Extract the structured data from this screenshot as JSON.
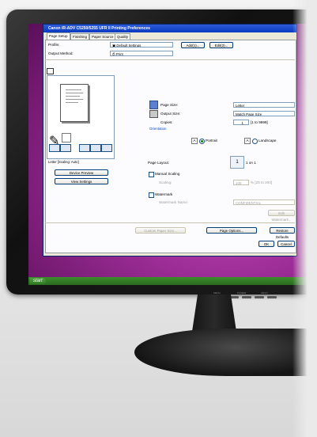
{
  "window": {
    "title": "Canon iR-ADV C5250/5255 UFR II Printing Preferences"
  },
  "tabs": [
    "Page Setup",
    "Finishing",
    "Paper Source",
    "Quality"
  ],
  "profile": {
    "label": "Profile:",
    "value": "Default Settings",
    "add_label": "Add(1)...",
    "edit_label": "Edit(2)..."
  },
  "output_method": {
    "label": "Output Method:",
    "value": "Print"
  },
  "page_size": {
    "label": "Page Size:",
    "value": "Letter"
  },
  "output_size": {
    "label": "Output Size:",
    "value": "Match Page Size"
  },
  "copies": {
    "label": "Copies:",
    "value": "1",
    "range": "[1 to 9999]"
  },
  "orientation": {
    "group_label": "Orientation",
    "portrait": "Portrait",
    "landscape": "Landscape",
    "letter": "A"
  },
  "page_layout": {
    "label": "Page Layout:",
    "value": "1 on 1",
    "num": "1"
  },
  "manual_scaling": {
    "label": "Manual Scaling",
    "scaling_label": "Scaling:",
    "value": "100",
    "range": "% [25 to 200]"
  },
  "watermark": {
    "label": "Watermark",
    "name_label": "Watermark Name:",
    "value": "CONFIDENTIAL",
    "edit_label": "Edit Watermark..."
  },
  "preview": {
    "caption": "Letter [Scaling: Auto]",
    "device_preview": "Device Preview",
    "view_settings": "View Settings"
  },
  "buttons": {
    "custom_paper": "Custom Paper Size...",
    "page_options": "Page Options...",
    "restore": "Restore Defaults",
    "ok": "OK",
    "cancel": "Cancel"
  },
  "taskbar": {
    "start": "start"
  },
  "monitor": {
    "controls": [
      "MENU",
      "POWER",
      "INPUT"
    ]
  }
}
